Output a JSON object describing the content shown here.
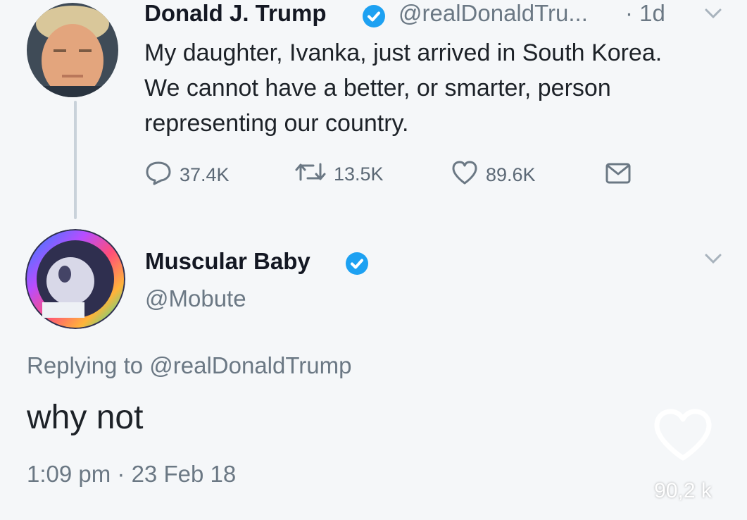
{
  "tweet": {
    "author_name": "Donald J. Trump",
    "author_handle": "@realDonaldTru...",
    "time": "· 1d",
    "text": "My daughter, Ivanka, just arrived in South Korea. We cannot have a better, or smarter, person representing our country.",
    "replies": "37.4K",
    "retweets": "13.5K",
    "likes": "89.6K"
  },
  "reply": {
    "author_name": "Muscular Baby",
    "author_handle": "@Mobute",
    "replying_to": "Replying to @realDonaldTrump",
    "text": "why not",
    "timestamp": "1:09 pm · 23 Feb 18"
  },
  "overlay": {
    "like_count": "90,2 k"
  },
  "colors": {
    "verified": "#1da1f2",
    "muted_text": "#6b7884",
    "background": "#f5f7f9"
  },
  "icons": [
    "verified-badge-icon",
    "chevron-down-icon",
    "reply-icon",
    "retweet-icon",
    "heart-icon",
    "direct-message-icon"
  ]
}
